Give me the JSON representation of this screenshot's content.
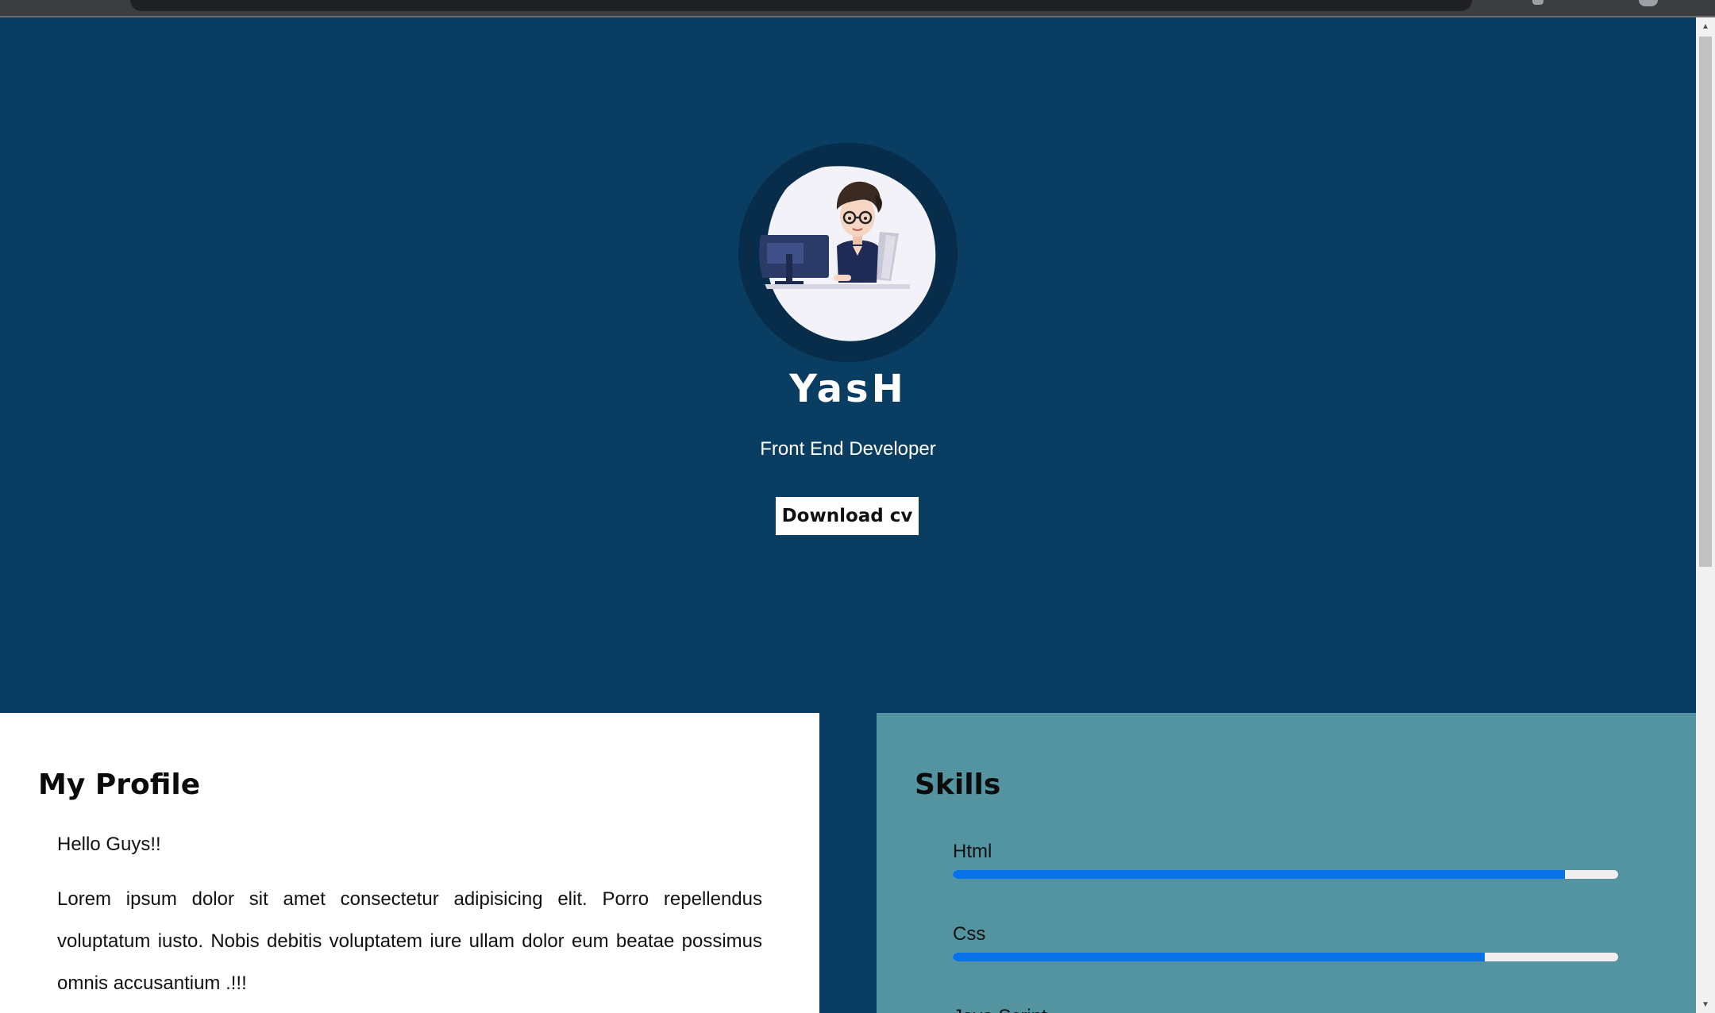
{
  "hero": {
    "name": "YasH",
    "role": "Front End Developer",
    "cv_button": "Download cv"
  },
  "profile": {
    "title": "My Profile",
    "greeting": "Hello Guys!!",
    "body": "Lorem ipsum dolor sit amet consectetur adipisicing elit. Porro repellendus voluptatum iusto. Nobis debitis voluptatem iure ullam dolor eum beatae possimus omnis accusantium .!!!"
  },
  "skills": {
    "title": "Skills",
    "items": [
      {
        "label": "Html",
        "level": 0.92
      },
      {
        "label": "Css",
        "level": 0.8
      },
      {
        "label": "Java Script",
        "level": null
      }
    ]
  },
  "colors": {
    "hero_background": "#0a3d62",
    "skills_background": "#5494a0",
    "progress_fill": "#0a72e8",
    "progress_track": "#efefef"
  },
  "icons": {
    "avatar": "developer-at-computer-avatar"
  }
}
